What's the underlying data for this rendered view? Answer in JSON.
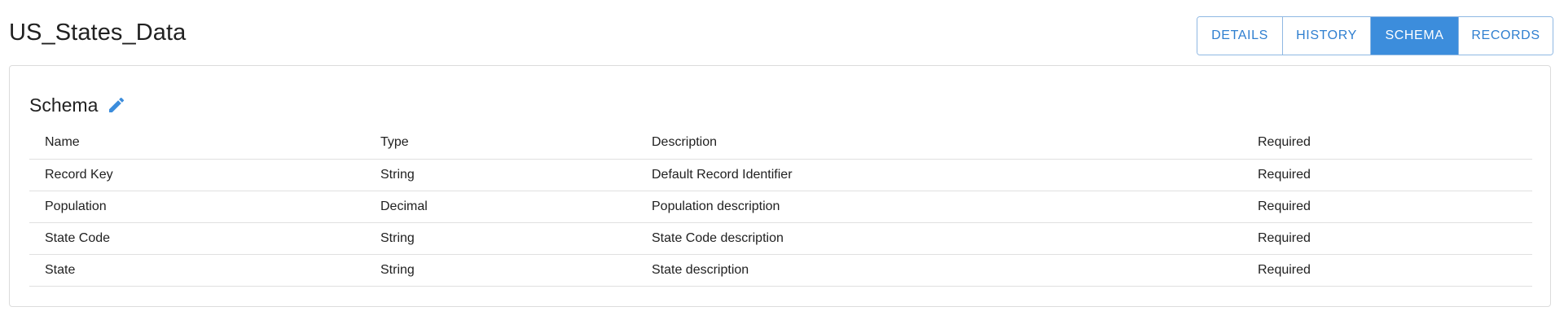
{
  "header": {
    "title": "US_States_Data",
    "tabs": [
      {
        "label": "DETAILS",
        "active": false
      },
      {
        "label": "HISTORY",
        "active": false
      },
      {
        "label": "SCHEMA",
        "active": true
      },
      {
        "label": "RECORDS",
        "active": false
      }
    ]
  },
  "schema": {
    "title": "Schema",
    "edit_icon": "pencil-icon",
    "columns": [
      "Name",
      "Type",
      "Description",
      "Required"
    ],
    "rows": [
      {
        "name": "Record Key",
        "type": "String",
        "description": "Default Record Identifier",
        "required": "Required"
      },
      {
        "name": "Population",
        "type": "Decimal",
        "description": "Population description",
        "required": "Required"
      },
      {
        "name": "State Code",
        "type": "String",
        "description": "State Code description",
        "required": "Required"
      },
      {
        "name": "State",
        "type": "String",
        "description": "State description",
        "required": "Required"
      }
    ]
  },
  "colors": {
    "accent": "#3c8ddc",
    "tab_text": "#2f7fd0",
    "tab_border": "#8fb8e3",
    "divider": "#e0e0e0"
  }
}
